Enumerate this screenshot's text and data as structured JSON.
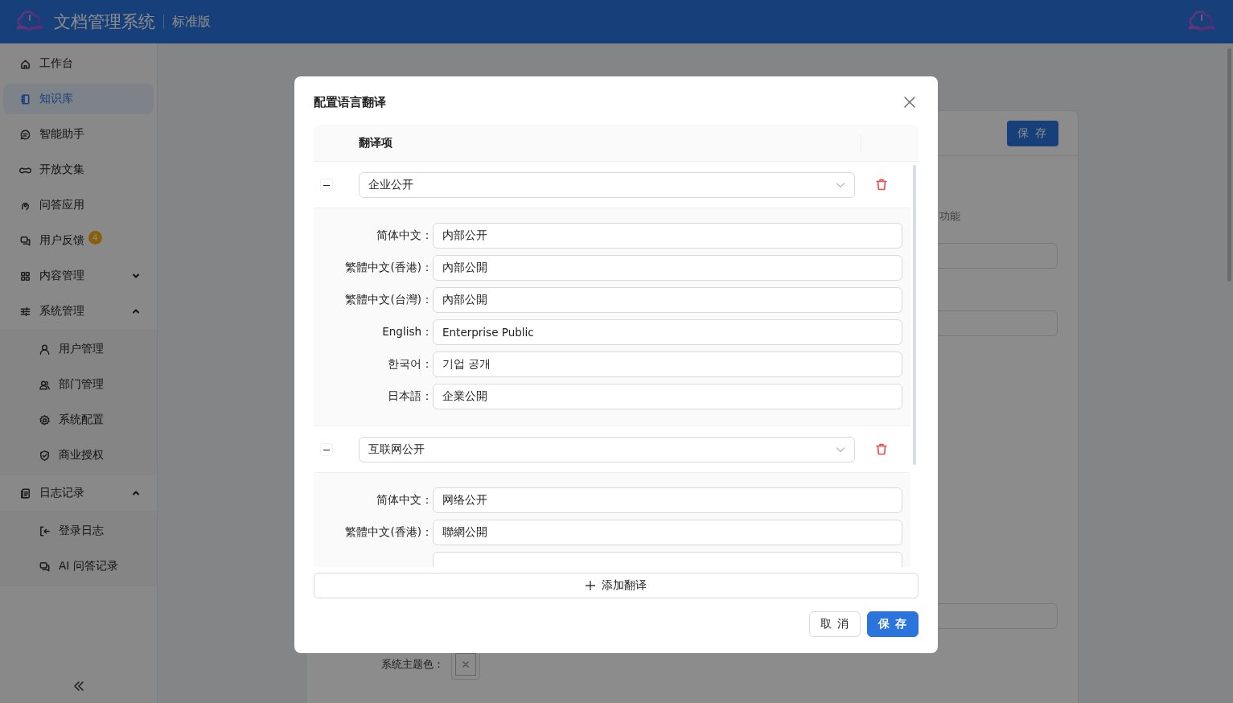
{
  "header": {
    "title": "文档管理系统",
    "edition": "标准版"
  },
  "sidebar": {
    "items": [
      {
        "label": "工作台",
        "selected": false
      },
      {
        "label": "知识库",
        "selected": true
      },
      {
        "label": "智能助手",
        "selected": false
      },
      {
        "label": "开放文集",
        "selected": false
      },
      {
        "label": "问答应用",
        "selected": false
      },
      {
        "label": "用户反馈",
        "selected": false,
        "badge": "4"
      },
      {
        "label": "内容管理",
        "selected": false,
        "expanded": false
      },
      {
        "label": "系统管理",
        "selected": false,
        "expanded": true,
        "children": [
          {
            "label": "用户管理",
            "selected": false
          },
          {
            "label": "部门管理",
            "selected": false
          },
          {
            "label": "系统配置",
            "selected": false
          },
          {
            "label": "商业授权",
            "selected": false
          }
        ]
      },
      {
        "label": "日志记录",
        "selected": false,
        "expanded": true,
        "children": [
          {
            "label": "登录日志",
            "selected": false
          },
          {
            "label": "AI 问答记录",
            "selected": false
          }
        ]
      }
    ]
  },
  "background": {
    "save_button": "保 存",
    "note": "功能",
    "theme_color_label": "系统主题色："
  },
  "modal": {
    "title": "配置语言翻译",
    "column": "翻译项",
    "groups": [
      {
        "value": "企业公开",
        "expanded": true,
        "translations": [
          {
            "language": "简体中文：",
            "value": "内部公开"
          },
          {
            "language": "繁體中文(香港)：",
            "value": "內部公開"
          },
          {
            "language": "繁體中文(台灣)：",
            "value": "內部公開"
          },
          {
            "language": "English：",
            "value": "Enterprise Public"
          },
          {
            "language": "한국어：",
            "value": "기업 공개"
          },
          {
            "language": "日本語：",
            "value": "企業公開"
          }
        ]
      },
      {
        "value": "互联网公开",
        "expanded": true,
        "translations": [
          {
            "language": "简体中文：",
            "value": "网络公开"
          },
          {
            "language": "繁體中文(香港)：",
            "value": "聯網公開"
          }
        ]
      }
    ],
    "add_button": "添加翻译",
    "cancel_button": "取 消",
    "save_button": "保 存"
  }
}
